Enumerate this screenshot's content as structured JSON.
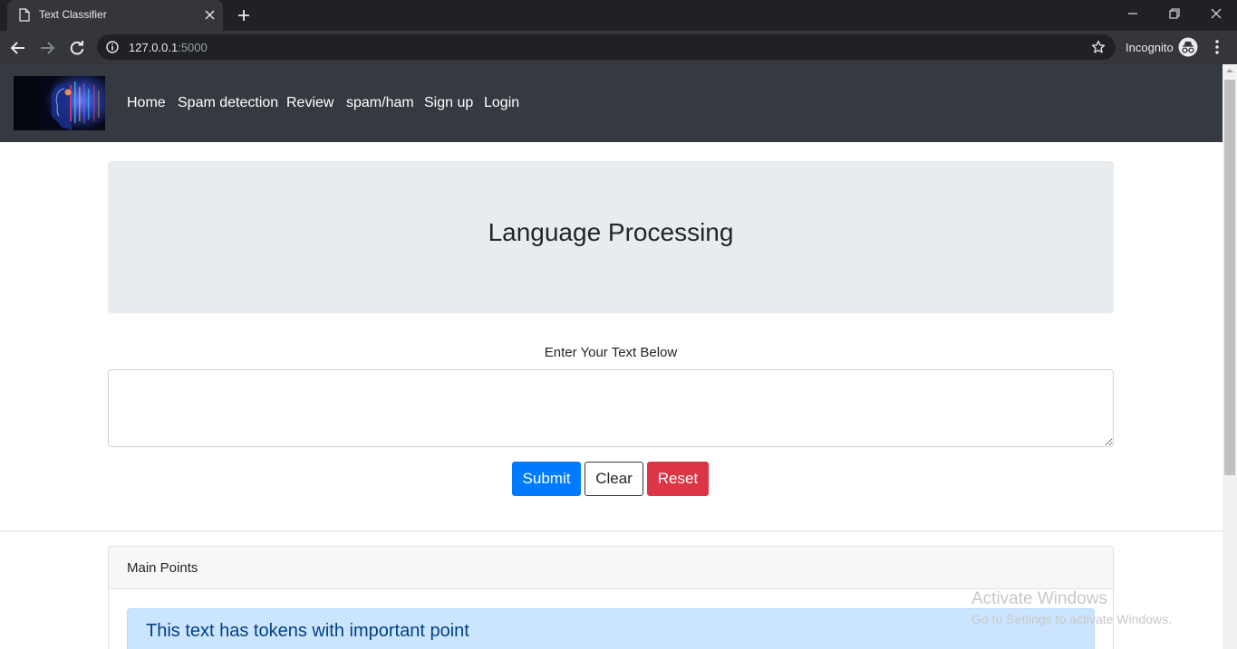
{
  "browser": {
    "tab_title": "Text Classifier",
    "url_host": "127.0.0.1",
    "url_port": ":5000",
    "incognito_label": "Incognito"
  },
  "navbar": {
    "links": [
      "Home",
      "Spam detection",
      "Review",
      "spam/ham",
      "Sign up",
      "Login"
    ]
  },
  "hero": {
    "title": "Language Processing"
  },
  "form": {
    "label": "Enter Your Text Below",
    "textarea_value": "",
    "submit_label": "Submit",
    "clear_label": "Clear",
    "reset_label": "Reset"
  },
  "card": {
    "header": "Main Points",
    "alert_text": "This text has tokens with important point"
  },
  "watermark": {
    "title": "Activate Windows",
    "subtitle": "Go to Settings to activate Windows."
  },
  "colors": {
    "navbar_bg": "#343a40",
    "jumbotron_bg": "#e9ecef",
    "primary": "#007bff",
    "danger": "#dc3545",
    "alert_bg": "#cce5ff",
    "alert_text": "#004085"
  }
}
